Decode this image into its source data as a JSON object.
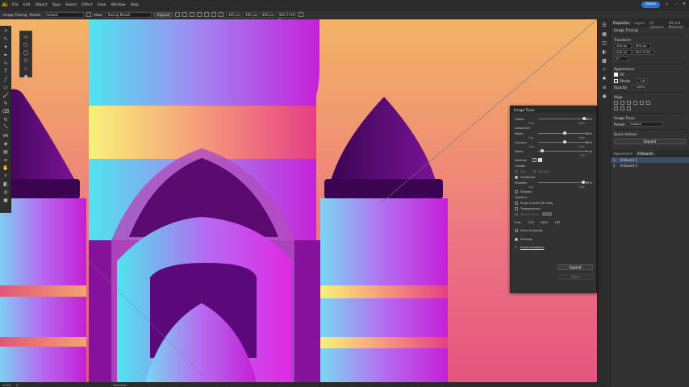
{
  "menu": {
    "logo": "Ai",
    "items": [
      "File",
      "Edit",
      "Object",
      "Type",
      "Select",
      "Effect",
      "View",
      "Window",
      "Help"
    ],
    "share": "Share"
  },
  "control": {
    "mode": "Image Tracing",
    "preset_label": "Preset:",
    "preset_value": "Custom",
    "view_label": "View:",
    "view_value": "Tracing Result",
    "expand": "Expand",
    "x": "400 px",
    "y": "400 px",
    "w": "800 px",
    "h": "802.5739 p"
  },
  "status": {
    "zoom": "400%",
    "angle": "0°",
    "mode": "Selection"
  },
  "properties": {
    "tabs": [
      "Properties",
      "Layers",
      "CC Libraries",
      "3D and Materials"
    ],
    "object_type": "Image Tracing",
    "transform_title": "Transform",
    "x": "400 px",
    "y": "400 px",
    "w": "800 px",
    "h": "802.5739",
    "angle": "0°",
    "appearance_title": "Appearance",
    "fill_label": "Fill",
    "stroke_label": "Stroke",
    "stroke_value": "1 pt",
    "opacity_label": "Opacity",
    "opacity_value": "100%",
    "align_title": "Align",
    "image_trace_title": "Image Trace",
    "preset_label": "Preset:",
    "preset_value": "Custom",
    "quick_actions": "Quick Actions",
    "expand_button": "Expand"
  },
  "layers": {
    "tabs": [
      "Appearance",
      "Artboards"
    ],
    "items": [
      {
        "num": "1",
        "name": "Artboard 1"
      },
      {
        "num": "2",
        "name": "Artboard 2"
      }
    ]
  },
  "trace": {
    "title": "Image Trace",
    "colors_label": "Colors",
    "colors_value": "89%",
    "colors_less": "Less",
    "colors_more": "More",
    "advanced_label": "Advanced",
    "paths_label": "Paths",
    "paths_value": "50%",
    "paths_low": "Low",
    "paths_high": "High",
    "corners_label": "Corners",
    "corners_value": "50%",
    "corners_less": "Less",
    "corners_more": "More",
    "noise_label": "Noise",
    "noise_value": "5 px",
    "noise_min": "1",
    "noise_max": "100",
    "method_label": "Method:",
    "create_label": "Create:",
    "fills_label": "Fills",
    "strokes_label": "Strokes",
    "gradients_label": "Gradients",
    "smooth_label": "Smooth:",
    "smooth_value": "87%",
    "smooth_low": "Low",
    "smooth_high": "High",
    "shapes_label": "Shapes",
    "options_label": "Options:",
    "snap_label": "Snap Curves To Lines",
    "transparency_label": "Transparency",
    "ignore_label": "Ignore Color",
    "info_label": "Info:",
    "info_paths": "218",
    "info_anchors": "4461",
    "info_colors": "181",
    "auto_group_label": "Auto Grouping",
    "expand_button": "Expand",
    "preview_label": "Preview",
    "trace_button": "Trace",
    "feedback_label": "Share feedback"
  },
  "colors": {
    "accent": "#2a73d9",
    "bg_top": "#f2b466",
    "bg_bottom": "#e6547f",
    "purple_dark": "#5b0b6f",
    "magenta": "#c520d8",
    "cyan": "#4fe5ee"
  }
}
